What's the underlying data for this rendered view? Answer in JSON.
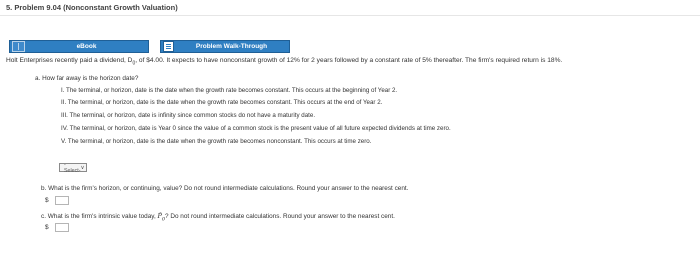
{
  "title": "5. Problem 9.04 (Nonconstant Growth Valuation)",
  "buttons": {
    "ebook": "eBook",
    "walkthrough": "Problem Walk-Through"
  },
  "problem": {
    "text_before": "Holt Enterprises recently paid a dividend, D",
    "d_sub": "0",
    "text_after": ", of $4.00. It expects to have nonconstant growth of 12% for 2 years followed by a constant rate of 5% thereafter. The firm's required return is 18%."
  },
  "question_a": {
    "prompt": "a. How far away is the horizon date?",
    "options": [
      "I. The terminal, or horizon, date is the date when the growth rate becomes constant. This occurs at the beginning of Year 2.",
      "II. The terminal, or horizon, date is the date when the growth rate becomes constant. This occurs at the end of Year 2.",
      "III. The terminal, or horizon, date is infinity since common stocks do not have a maturity date.",
      "IV. The terminal, or horizon, date is Year 0 since the value of a common stock is the present value of all future expected dividends at time zero.",
      "V. The terminal, or horizon, date is the date when the growth rate becomes nonconstant. This occurs at time zero."
    ],
    "select_value": "-Select-"
  },
  "question_b": {
    "prompt": "b. What is the firm's horizon, or continuing, value? Do not round intermediate calculations. Round your answer to the nearest cent.",
    "currency": "$",
    "value": ""
  },
  "question_c": {
    "prompt_before": "c. What is the firm's intrinsic value today, ",
    "p_label": "P",
    "p_sub": "0",
    "prompt_after": "? Do not round intermediate calculations. Round your answer to the nearest cent.",
    "currency": "$",
    "value": ""
  },
  "icons": {
    "ebook": "book-icon",
    "walkthrough": "document-icon",
    "dropdown": "chevron-down-icon"
  },
  "colors": {
    "button_blue": "#2f7fc2"
  }
}
